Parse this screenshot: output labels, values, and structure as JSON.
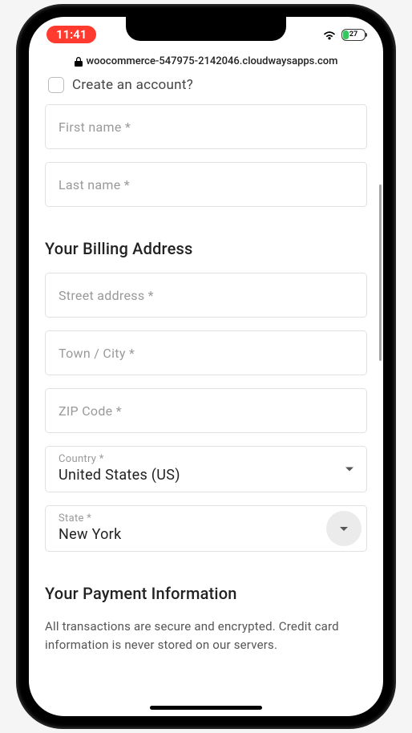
{
  "status": {
    "time": "11:41",
    "battery_pct": "27"
  },
  "url": "woocommerce-547975-2142046.cloudwaysapps.com",
  "account": {
    "label": "Create an account?"
  },
  "name_fields": {
    "first_placeholder": "First name *",
    "last_placeholder": "Last name *"
  },
  "billing": {
    "title": "Your Billing Address",
    "street_placeholder": "Street address *",
    "city_placeholder": "Town / City *",
    "zip_placeholder": "ZIP Code *",
    "country_label": "Country *",
    "country_value": "United States (US)",
    "state_label": "State *",
    "state_value": "New York"
  },
  "payment": {
    "title": "Your Payment Information",
    "desc": "All transactions are secure and encrypted. Credit card information is never stored on our servers."
  }
}
